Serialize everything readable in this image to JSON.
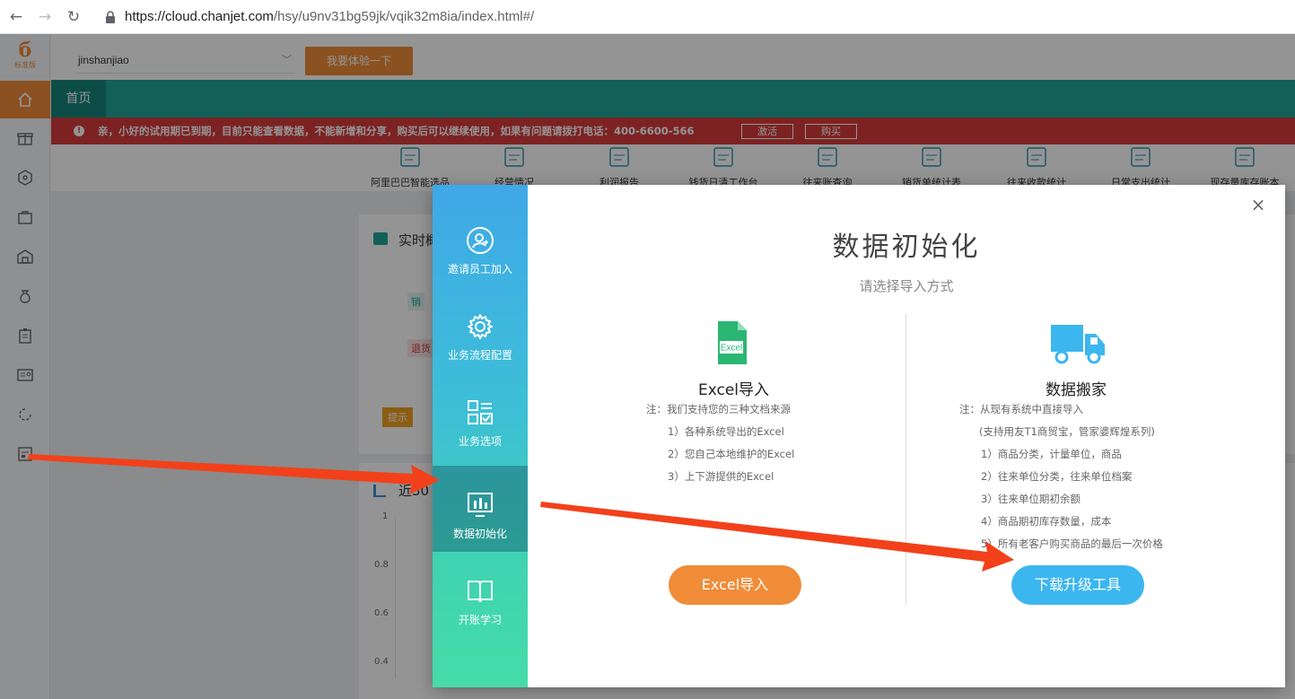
{
  "browser": {
    "url_host": "https://cloud.chanjet.com",
    "url_path": "/hsy/u9nv31bg59jk/vqik32m8ia/index.html#/"
  },
  "sidebar": {
    "logo_sub": "标准版",
    "icons": [
      "home-icon",
      "gift-icon",
      "cube-icon",
      "bag-icon",
      "warehouse-icon",
      "moneybag-icon",
      "clipboard-icon",
      "contact-card-icon",
      "refresh-icon",
      "report-icon"
    ]
  },
  "topbar": {
    "company": "jinshanjiao",
    "try_button": "我要体验一下"
  },
  "tabs": {
    "home": "首页"
  },
  "alert": {
    "message": "亲，小好的试用期已到期，目前只能查看数据，不能新增和分享，购买后可以继续使用，如果有问题请拨打电话：400-6600-566",
    "activate": "激活",
    "buy": "购买"
  },
  "quick_links": [
    "阿里巴巴智能选品",
    "经营情况",
    "利润报告",
    "钱货日清工作台",
    "往来账查询",
    "销货单统计表",
    "往来收款统计",
    "日常支出统计",
    "现存量库存账本"
  ],
  "background": {
    "realtime_title": "实时概",
    "sales_tag": "销",
    "return_tag": "退货",
    "tip_tag": "提示",
    "chart_title": "近30",
    "y_ticks": [
      "1",
      "0.8",
      "0.6",
      "0.4"
    ]
  },
  "modal": {
    "menu": [
      {
        "label": "邀请员工加入",
        "icon": "invite-icon"
      },
      {
        "label": "业务流程配置",
        "icon": "gear-icon"
      },
      {
        "label": "业务选项",
        "icon": "options-icon"
      },
      {
        "label": "数据初始化",
        "icon": "chart-monitor-icon"
      },
      {
        "label": "开账学习",
        "icon": "book-icon"
      }
    ],
    "title": "数据初始化",
    "subtitle": "请选择导入方式",
    "close": "×",
    "excel": {
      "icon_text": "Excel",
      "heading": "Excel导入",
      "notes": [
        "注：我们支持您的三种文档来源",
        "1）各种系统导出的Excel",
        "2）您自己本地维护的Excel",
        "3）上下游提供的Excel"
      ],
      "button": "Excel导入"
    },
    "mover": {
      "heading": "数据搬家",
      "notes": [
        "注：从现有系统中直接导入",
        "(支持用友T1商贸宝，管家婆辉煌系列)",
        "1）商品分类，计量单位，商品",
        "2）往来单位分类，往来单位档案",
        "3）往来单位期初余额",
        "4）商品期初库存数量，成本",
        "5）所有老客户购买商品的最后一次价格"
      ],
      "button": "下载升级工具"
    }
  },
  "colors": {
    "accent_orange": "#f08c38",
    "teal": "#1fa598",
    "alert_red": "#d83b3b",
    "tool_blue": "#3cb6ef",
    "arrow_red": "#f2411a"
  }
}
